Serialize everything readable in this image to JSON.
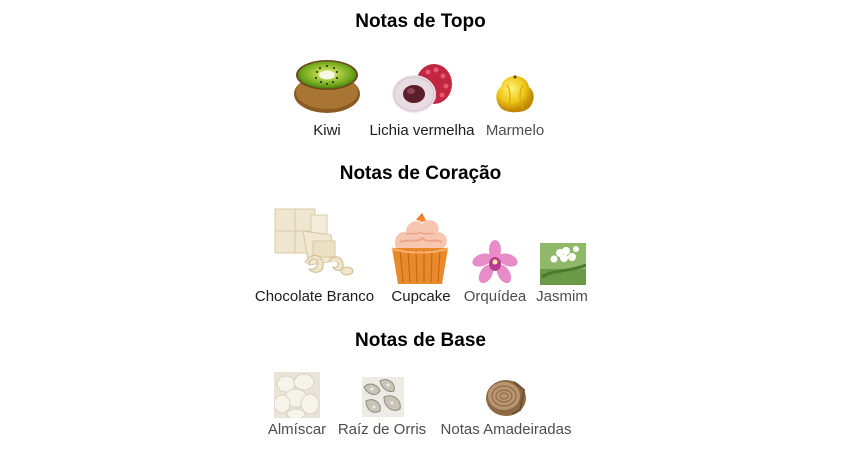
{
  "sections": {
    "top": {
      "title": "Notas de Topo",
      "notes": [
        {
          "label": "Kiwi",
          "icon": "kiwi-image"
        },
        {
          "label": "Lichia vermelha",
          "icon": "lychee-image"
        },
        {
          "label": "Marmelo",
          "icon": "quince-image"
        }
      ]
    },
    "heart": {
      "title": "Notas de Coração",
      "notes": [
        {
          "label": "Chocolate Branco",
          "icon": "white-chocolate-image"
        },
        {
          "label": "Cupcake",
          "icon": "cupcake-image"
        },
        {
          "label": "Orquídea",
          "icon": "orchid-image"
        },
        {
          "label": "Jasmim",
          "icon": "jasmine-image"
        }
      ]
    },
    "base": {
      "title": "Notas de Base",
      "notes": [
        {
          "label": "Almíscar",
          "icon": "musk-image"
        },
        {
          "label": "Raíz de Orris",
          "icon": "orris-root-image"
        },
        {
          "label": "Notas Amadeiradas",
          "icon": "woody-notes-image"
        }
      ]
    }
  },
  "colors": {
    "text": "#000000",
    "label_text": "#1c1c1c",
    "label_text_muted": "#4d4d4d",
    "background": "#ffffff"
  }
}
